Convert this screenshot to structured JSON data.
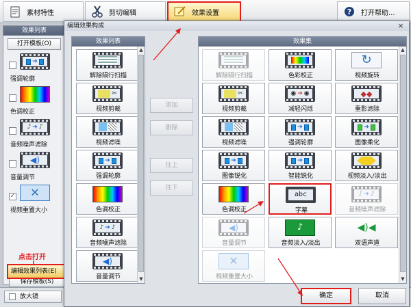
{
  "toolbar": {
    "props": "素材特性",
    "cut": "剪切编辑",
    "effects": "效果设置",
    "help": "打开帮助..."
  },
  "left_panel": {
    "title": "效果列表",
    "open_template": "打开模板(O)",
    "items": [
      {
        "label": "强调轮廓",
        "checked": false,
        "icon": "outline-icon"
      },
      {
        "label": "色调校正",
        "checked": false,
        "icon": "color-bars-icon"
      },
      {
        "label": "音频噪声滤除",
        "checked": false,
        "icon": "audio-noise-icon"
      },
      {
        "label": "音量调节",
        "checked": false,
        "icon": "volume-icon"
      },
      {
        "label": "视频重置大小",
        "checked": true,
        "icon": "resize-icon"
      }
    ],
    "hint": "点击打开",
    "save_template": "保存模板(S)",
    "edit_list": "编辑效果列表(E)",
    "zoom": "放大镜"
  },
  "dialog": {
    "title": "编辑效果构成",
    "left_title": "效果列表",
    "right_title": "效果集",
    "buttons": {
      "add": "添加",
      "delete": "删除",
      "up": "往上",
      "down": "往下"
    },
    "ok": "确定",
    "cancel": "取消",
    "list": [
      {
        "label": "解除隔行扫描",
        "icon": "deinterlace-icon"
      },
      {
        "label": "视频剪裁",
        "icon": "crop-icon"
      },
      {
        "label": "视频滤噪",
        "icon": "denoise-icon"
      },
      {
        "label": "强调轮廓",
        "icon": "outline-icon"
      },
      {
        "label": "色调校正",
        "icon": "color-bars-icon"
      },
      {
        "label": "音频噪声滤除",
        "icon": "audio-noise-icon"
      },
      {
        "label": "音量调节",
        "icon": "volume-icon"
      }
    ],
    "effects": [
      {
        "label": "解除隔行扫描",
        "icon": "deinterlace-icon",
        "disabled": true
      },
      {
        "label": "色彩校正",
        "icon": "color-correct-icon",
        "disabled": false
      },
      {
        "label": "视频旋转",
        "icon": "rotate-icon",
        "disabled": false
      },
      {
        "label": "视频剪裁",
        "icon": "crop-icon",
        "disabled": false
      },
      {
        "label": "减轻闪烁",
        "icon": "flicker-icon",
        "disabled": false
      },
      {
        "label": "重影滤除",
        "icon": "ghost-icon",
        "disabled": false
      },
      {
        "label": "视频滤噪",
        "icon": "denoise-icon",
        "disabled": false
      },
      {
        "label": "强调轮廓",
        "icon": "outline-icon",
        "disabled": false
      },
      {
        "label": "图像柔化",
        "icon": "soften-icon",
        "disabled": false
      },
      {
        "label": "图像锐化",
        "icon": "sharpen-icon",
        "disabled": false
      },
      {
        "label": "智能锐化",
        "icon": "smart-sharpen-icon",
        "disabled": false
      },
      {
        "label": "视频淡入/淡出",
        "icon": "video-fade-icon",
        "disabled": false
      },
      {
        "label": "色调校正",
        "icon": "color-bars-icon",
        "disabled": false
      },
      {
        "label": "字幕",
        "icon": "subtitle-icon",
        "disabled": false,
        "highlight": true
      },
      {
        "label": "音频噪声滤除",
        "icon": "audio-noise-icon",
        "disabled": true
      },
      {
        "label": "音量调节",
        "icon": "volume-icon",
        "disabled": true
      },
      {
        "label": "音频淡入/淡出",
        "icon": "audio-fade-icon",
        "disabled": false
      },
      {
        "label": "双语声道",
        "icon": "dual-channel-icon",
        "disabled": false
      },
      {
        "label": "视频重置大小",
        "icon": "resize-icon",
        "disabled": true
      }
    ]
  }
}
